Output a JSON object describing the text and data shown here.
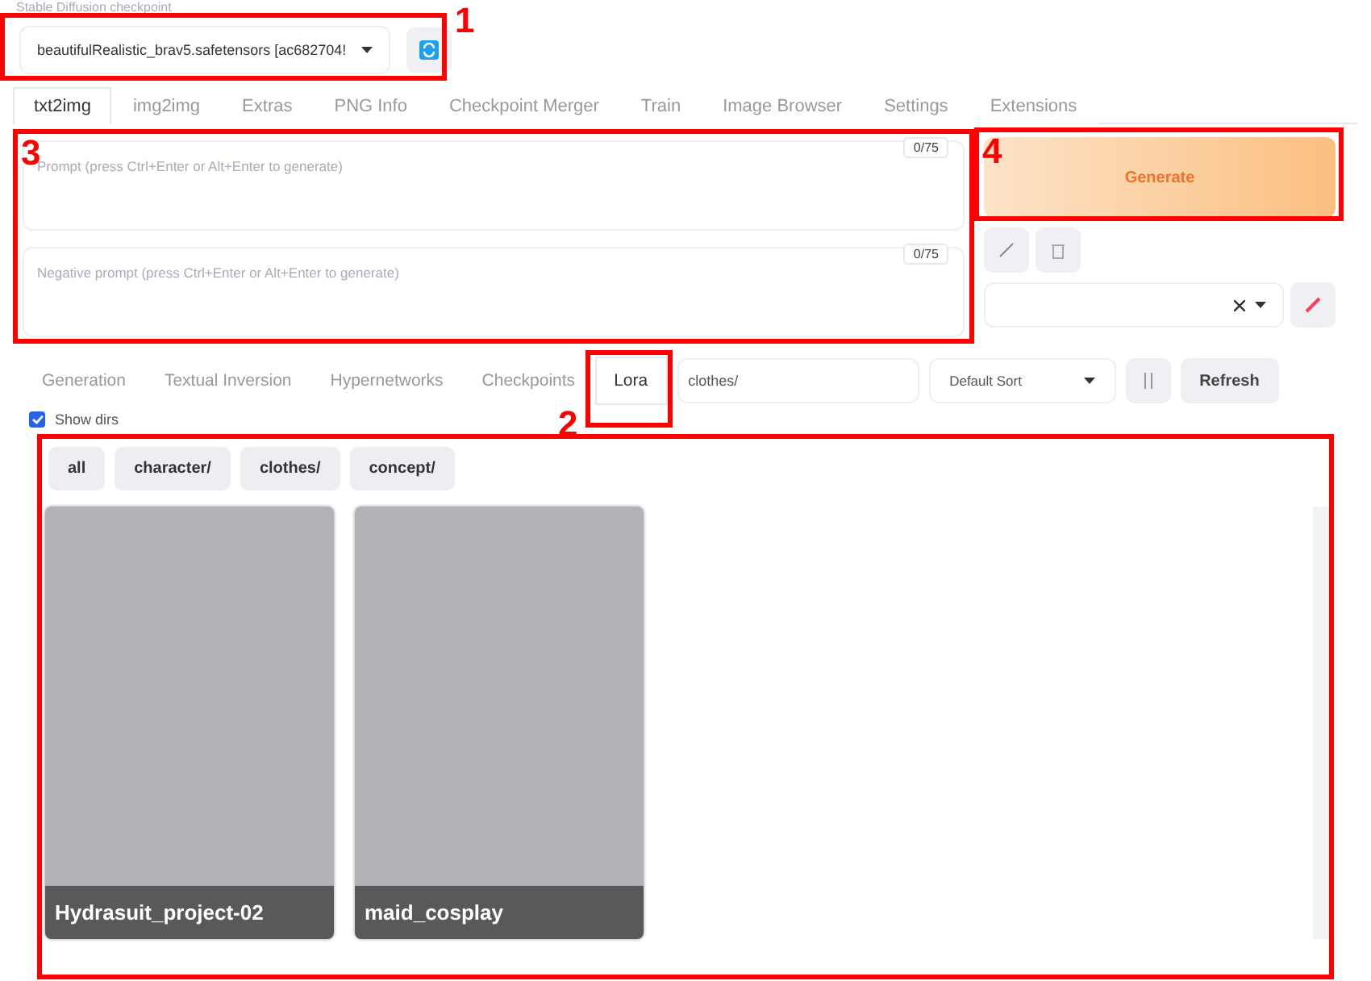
{
  "checkpoint": {
    "label": "Stable Diffusion checkpoint",
    "value": "beautifulRealistic_brav5.safetensors [ac682704!"
  },
  "tabs": [
    {
      "label": "txt2img",
      "selected": true
    },
    {
      "label": "img2img",
      "selected": false
    },
    {
      "label": "Extras",
      "selected": false
    },
    {
      "label": "PNG Info",
      "selected": false
    },
    {
      "label": "Checkpoint Merger",
      "selected": false
    },
    {
      "label": "Train",
      "selected": false
    },
    {
      "label": "Image Browser",
      "selected": false
    },
    {
      "label": "Settings",
      "selected": false
    },
    {
      "label": "Extensions",
      "selected": false
    }
  ],
  "prompt": {
    "placeholder": "Prompt (press Ctrl+Enter or Alt+Enter to generate)",
    "counter": "0/75"
  },
  "negative_prompt": {
    "placeholder": "Negative prompt (press Ctrl+Enter or Alt+Enter to generate)",
    "counter": "0/75"
  },
  "generate_button": "Generate",
  "network_tabs": [
    {
      "label": "Generation",
      "selected": false
    },
    {
      "label": "Textual Inversion",
      "selected": false
    },
    {
      "label": "Hypernetworks",
      "selected": false
    },
    {
      "label": "Checkpoints",
      "selected": false
    },
    {
      "label": "Lora",
      "selected": true
    }
  ],
  "search": {
    "value": "clothes/"
  },
  "sort": {
    "value": "Default Sort"
  },
  "refresh_button": "Refresh",
  "show_dirs": {
    "label": "Show dirs",
    "checked": true
  },
  "dir_filters": [
    "all",
    "character/",
    "clothes/",
    "concept/"
  ],
  "cards": [
    {
      "name": "Hydrasuit_project-02"
    },
    {
      "name": "maid_cosplay"
    }
  ],
  "annotations": [
    {
      "kind": "numbered",
      "number": "1"
    },
    {
      "kind": "numbered",
      "number": "3"
    },
    {
      "kind": "numbered",
      "number": "4"
    },
    {
      "kind": "numbered",
      "number": "2"
    },
    {
      "kind": "plain"
    }
  ]
}
